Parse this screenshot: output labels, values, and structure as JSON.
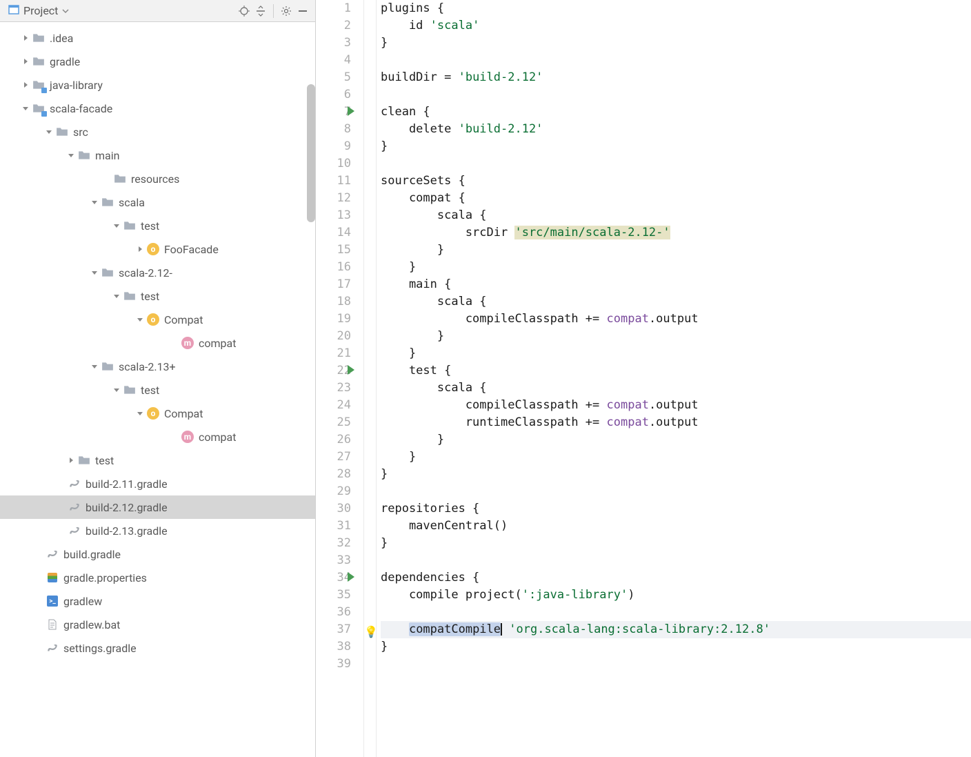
{
  "sidebar_header": {
    "project_label": "Project"
  },
  "tree": [
    {
      "indent": 28,
      "arrow": "right",
      "icon": "folder",
      "label": ".idea"
    },
    {
      "indent": 28,
      "arrow": "right",
      "icon": "folder",
      "label": "gradle"
    },
    {
      "indent": 28,
      "arrow": "right",
      "icon": "folder-blue",
      "label": "java-library"
    },
    {
      "indent": 28,
      "arrow": "down",
      "icon": "folder-blue",
      "label": "scala-facade"
    },
    {
      "indent": 62,
      "arrow": "down",
      "icon": "folder",
      "label": "src"
    },
    {
      "indent": 94,
      "arrow": "down",
      "icon": "folder",
      "label": "main"
    },
    {
      "indent": 146,
      "arrow": "",
      "icon": "folder",
      "label": "resources"
    },
    {
      "indent": 128,
      "arrow": "down",
      "icon": "folder",
      "label": "scala"
    },
    {
      "indent": 160,
      "arrow": "down",
      "icon": "folder",
      "label": "test"
    },
    {
      "indent": 194,
      "arrow": "right",
      "icon": "object",
      "label": "FooFacade"
    },
    {
      "indent": 128,
      "arrow": "down",
      "icon": "folder",
      "label": "scala-2.12-"
    },
    {
      "indent": 160,
      "arrow": "down",
      "icon": "folder",
      "label": "test"
    },
    {
      "indent": 194,
      "arrow": "down",
      "icon": "object",
      "label": "Compat"
    },
    {
      "indent": 244,
      "arrow": "",
      "icon": "method",
      "label": "compat"
    },
    {
      "indent": 128,
      "arrow": "down",
      "icon": "folder",
      "label": "scala-2.13+"
    },
    {
      "indent": 160,
      "arrow": "down",
      "icon": "folder",
      "label": "test"
    },
    {
      "indent": 194,
      "arrow": "down",
      "icon": "object",
      "label": "Compat"
    },
    {
      "indent": 244,
      "arrow": "",
      "icon": "method",
      "label": "compat"
    },
    {
      "indent": 94,
      "arrow": "right",
      "icon": "folder",
      "label": "test"
    },
    {
      "indent": 80,
      "arrow": "",
      "icon": "gradle",
      "label": "build-2.11.gradle"
    },
    {
      "indent": 80,
      "arrow": "",
      "icon": "gradle",
      "label": "build-2.12.gradle",
      "selected": true
    },
    {
      "indent": 80,
      "arrow": "",
      "icon": "gradle",
      "label": "build-2.13.gradle"
    },
    {
      "indent": 48,
      "arrow": "",
      "icon": "gradle",
      "label": "build.gradle"
    },
    {
      "indent": 48,
      "arrow": "",
      "icon": "props",
      "label": "gradle.properties"
    },
    {
      "indent": 48,
      "arrow": "",
      "icon": "terminal",
      "label": "gradlew"
    },
    {
      "indent": 48,
      "arrow": "",
      "icon": "textfile",
      "label": "gradlew.bat"
    },
    {
      "indent": 48,
      "arrow": "",
      "icon": "gradle",
      "label": "settings.gradle"
    }
  ],
  "code": {
    "lines": [
      {
        "n": 1,
        "run": false,
        "tokens": [
          {
            "t": "plugins {",
            "c": "text"
          }
        ]
      },
      {
        "n": 2,
        "run": false,
        "tokens": [
          {
            "t": "    id ",
            "c": "text"
          },
          {
            "t": "'scala'",
            "c": "string"
          }
        ]
      },
      {
        "n": 3,
        "run": false,
        "tokens": [
          {
            "t": "}",
            "c": "text"
          }
        ]
      },
      {
        "n": 4,
        "run": false,
        "tokens": []
      },
      {
        "n": 5,
        "run": false,
        "tokens": [
          {
            "t": "buildDir = ",
            "c": "text"
          },
          {
            "t": "'build-2.12'",
            "c": "string"
          }
        ]
      },
      {
        "n": 6,
        "run": false,
        "tokens": []
      },
      {
        "n": 7,
        "run": true,
        "tokens": [
          {
            "t": "clean {",
            "c": "text"
          }
        ]
      },
      {
        "n": 8,
        "run": false,
        "tokens": [
          {
            "t": "    delete ",
            "c": "text"
          },
          {
            "t": "'build-2.12'",
            "c": "string"
          }
        ]
      },
      {
        "n": 9,
        "run": false,
        "tokens": [
          {
            "t": "}",
            "c": "text"
          }
        ]
      },
      {
        "n": 10,
        "run": false,
        "tokens": []
      },
      {
        "n": 11,
        "run": false,
        "tokens": [
          {
            "t": "sourceSets {",
            "c": "text"
          }
        ]
      },
      {
        "n": 12,
        "run": false,
        "tokens": [
          {
            "t": "    compat {",
            "c": "text"
          }
        ]
      },
      {
        "n": 13,
        "run": false,
        "tokens": [
          {
            "t": "        scala {",
            "c": "text"
          }
        ]
      },
      {
        "n": 14,
        "run": false,
        "tokens": [
          {
            "t": "            srcDir ",
            "c": "text"
          },
          {
            "t": "'src/main/scala-2.12-'",
            "c": "string-hl"
          }
        ]
      },
      {
        "n": 15,
        "run": false,
        "tokens": [
          {
            "t": "        }",
            "c": "text"
          }
        ]
      },
      {
        "n": 16,
        "run": false,
        "tokens": [
          {
            "t": "    }",
            "c": "text"
          }
        ]
      },
      {
        "n": 17,
        "run": false,
        "tokens": [
          {
            "t": "    main {",
            "c": "text"
          }
        ]
      },
      {
        "n": 18,
        "run": false,
        "tokens": [
          {
            "t": "        scala {",
            "c": "text"
          }
        ]
      },
      {
        "n": 19,
        "run": false,
        "tokens": [
          {
            "t": "            compileClasspath += ",
            "c": "text"
          },
          {
            "t": "compat",
            "c": "prop"
          },
          {
            "t": ".output",
            "c": "text"
          }
        ]
      },
      {
        "n": 20,
        "run": false,
        "tokens": [
          {
            "t": "        }",
            "c": "text"
          }
        ]
      },
      {
        "n": 21,
        "run": false,
        "tokens": [
          {
            "t": "    }",
            "c": "text"
          }
        ]
      },
      {
        "n": 22,
        "run": true,
        "tokens": [
          {
            "t": "    test {",
            "c": "text"
          }
        ]
      },
      {
        "n": 23,
        "run": false,
        "tokens": [
          {
            "t": "        scala {",
            "c": "text"
          }
        ]
      },
      {
        "n": 24,
        "run": false,
        "tokens": [
          {
            "t": "            compileClasspath += ",
            "c": "text"
          },
          {
            "t": "compat",
            "c": "prop"
          },
          {
            "t": ".output",
            "c": "text"
          }
        ]
      },
      {
        "n": 25,
        "run": false,
        "tokens": [
          {
            "t": "            runtimeClasspath += ",
            "c": "text"
          },
          {
            "t": "compat",
            "c": "prop"
          },
          {
            "t": ".output",
            "c": "text"
          }
        ]
      },
      {
        "n": 26,
        "run": false,
        "tokens": [
          {
            "t": "        }",
            "c": "text"
          }
        ]
      },
      {
        "n": 27,
        "run": false,
        "tokens": [
          {
            "t": "    }",
            "c": "text"
          }
        ]
      },
      {
        "n": 28,
        "run": false,
        "tokens": [
          {
            "t": "}",
            "c": "text"
          }
        ]
      },
      {
        "n": 29,
        "run": false,
        "tokens": []
      },
      {
        "n": 30,
        "run": false,
        "tokens": [
          {
            "t": "repositories {",
            "c": "text"
          }
        ]
      },
      {
        "n": 31,
        "run": false,
        "tokens": [
          {
            "t": "    mavenCentral()",
            "c": "text"
          }
        ]
      },
      {
        "n": 32,
        "run": false,
        "tokens": [
          {
            "t": "}",
            "c": "text"
          }
        ]
      },
      {
        "n": 33,
        "run": false,
        "tokens": []
      },
      {
        "n": 34,
        "run": true,
        "tokens": [
          {
            "t": "dependencies {",
            "c": "text"
          }
        ]
      },
      {
        "n": 35,
        "run": false,
        "tokens": [
          {
            "t": "    compile project(",
            "c": "text"
          },
          {
            "t": "':java-library'",
            "c": "string"
          },
          {
            "t": ")",
            "c": "text"
          }
        ]
      },
      {
        "n": 36,
        "run": false,
        "tokens": []
      },
      {
        "n": 37,
        "run": false,
        "hl": true,
        "bulb": true,
        "tokens": [
          {
            "t": "    ",
            "c": "text"
          },
          {
            "t": "compatCompile",
            "c": "sel"
          },
          {
            "t": "CARET",
            "c": "caret"
          },
          {
            "t": " ",
            "c": "text"
          },
          {
            "t": "'org.scala-lang:scala-library:2.12.8'",
            "c": "string"
          }
        ]
      },
      {
        "n": 38,
        "run": false,
        "tokens": [
          {
            "t": "}",
            "c": "text"
          }
        ]
      },
      {
        "n": 39,
        "run": false,
        "tokens": []
      }
    ]
  }
}
